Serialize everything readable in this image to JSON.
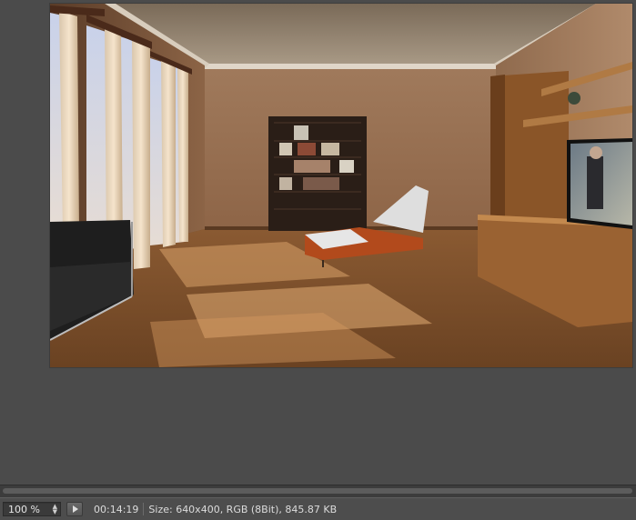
{
  "render": {
    "image_description_name": "rendered-interior-image"
  },
  "status": {
    "zoom_value": "100 %",
    "time": "00:14:19",
    "info": "Size: 640x400, RGB (8Bit), 845.87 KB"
  }
}
